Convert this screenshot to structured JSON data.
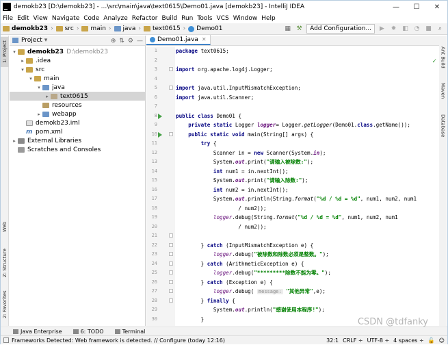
{
  "window": {
    "title": "demokb23 [D:\\demokb23] - ...\\src\\main\\java\\text0615\\Demo01.java [demokb23] - IntelliJ IDEA",
    "controls": [
      "—",
      "☐",
      "✕"
    ]
  },
  "menu": [
    "File",
    "Edit",
    "View",
    "Navigate",
    "Code",
    "Analyze",
    "Refactor",
    "Build",
    "Run",
    "Tools",
    "VCS",
    "Window",
    "Help"
  ],
  "breadcrumbs": [
    "demokb23",
    "src",
    "main",
    "java",
    "text0615",
    "Demo01"
  ],
  "toolbar": {
    "add_config": "Add Configuration..."
  },
  "left_tabs": [
    "1: Project",
    "Web",
    "Z: Structure",
    "2: Favorites"
  ],
  "right_tabs": [
    "Ant Build",
    "Maven",
    "Database"
  ],
  "project": {
    "header": "Project",
    "tree": [
      {
        "label": "demokb23",
        "extra": "D:\\demokb23",
        "depth": 0,
        "arrow": "▾",
        "icon": "fold",
        "bold": true
      },
      {
        "label": ".idea",
        "depth": 1,
        "arrow": "▸",
        "icon": "fold"
      },
      {
        "label": "src",
        "depth": 1,
        "arrow": "▾",
        "icon": "fold"
      },
      {
        "label": "main",
        "depth": 2,
        "arrow": "▾",
        "icon": "fold"
      },
      {
        "label": "java",
        "depth": 3,
        "arrow": "▾",
        "icon": "blue"
      },
      {
        "label": "text0615",
        "depth": 4,
        "arrow": "▸",
        "icon": "pkg",
        "selected": true
      },
      {
        "label": "resources",
        "depth": 3,
        "arrow": "",
        "icon": "res"
      },
      {
        "label": "webapp",
        "depth": 3,
        "arrow": "▸",
        "icon": "web"
      },
      {
        "label": "demokb23.iml",
        "depth": 1,
        "arrow": "",
        "icon": "iml"
      },
      {
        "label": "pom.xml",
        "depth": 1,
        "arrow": "",
        "icon": "pom"
      },
      {
        "label": "External Libraries",
        "depth": 0,
        "arrow": "▸",
        "icon": "lib"
      },
      {
        "label": "Scratches and Consoles",
        "depth": 0,
        "arrow": "",
        "icon": "scr"
      }
    ]
  },
  "editor": {
    "tab": "Demo01.java",
    "line_numbers": [
      "1",
      "2",
      "3",
      "4",
      "5",
      "6",
      "7",
      "8",
      "9",
      "10",
      "11",
      "12",
      "13",
      "14",
      "15",
      "16",
      "17",
      "18",
      "19",
      "20",
      "21",
      "22",
      "23",
      "24",
      "25",
      "26",
      "27",
      "28",
      "29",
      "30"
    ]
  },
  "bottom_tabs": [
    "Java Enterprise",
    "6: TODO",
    "Terminal"
  ],
  "status": {
    "message": "Frameworks Detected: Web framework is detected. // Configure (today 12:16)",
    "position": "32:1",
    "line_sep": "CRLF ÷",
    "encoding": "UTF-8 ÷",
    "indent": "4 spaces ÷"
  },
  "watermark": "CSDN @tdfanky"
}
